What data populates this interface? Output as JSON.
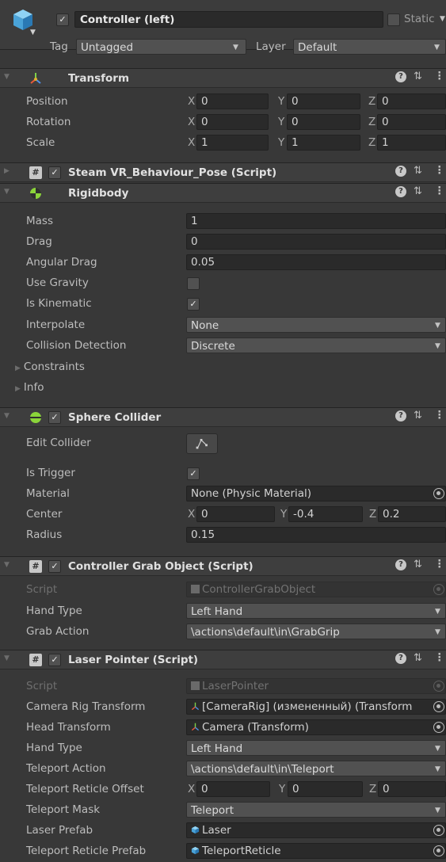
{
  "header": {
    "object_name": "Controller (left)",
    "active": true,
    "static_label": "Static",
    "tag_label": "Tag",
    "tag_value": "Untagged",
    "layer_label": "Layer",
    "layer_value": "Default"
  },
  "transform": {
    "title": "Transform",
    "rows": [
      {
        "label": "Position",
        "x": "0",
        "y": "0",
        "z": "0"
      },
      {
        "label": "Rotation",
        "x": "0",
        "y": "0",
        "z": "0"
      },
      {
        "label": "Scale",
        "x": "1",
        "y": "1",
        "z": "1"
      }
    ],
    "axis": {
      "x": "X",
      "y": "Y",
      "z": "Z"
    }
  },
  "steamvr_pose": {
    "title": "Steam VR_Behaviour_Pose (Script)",
    "enabled": true
  },
  "rigidbody": {
    "title": "Rigidbody",
    "mass_label": "Mass",
    "mass": "1",
    "drag_label": "Drag",
    "drag": "0",
    "angular_drag_label": "Angular Drag",
    "angular_drag": "0.05",
    "use_gravity_label": "Use Gravity",
    "use_gravity": false,
    "is_kinematic_label": "Is Kinematic",
    "is_kinematic": true,
    "interpolate_label": "Interpolate",
    "interpolate": "None",
    "collision_label": "Collision Detection",
    "collision": "Discrete",
    "constraints_label": "Constraints",
    "info_label": "Info"
  },
  "sphere_collider": {
    "title": "Sphere Collider",
    "enabled": true,
    "edit_label": "Edit Collider",
    "is_trigger_label": "Is Trigger",
    "is_trigger": true,
    "material_label": "Material",
    "material": "None (Physic Material)",
    "center_label": "Center",
    "center_x": "0",
    "center_y": "-0.4",
    "center_z": "0.2",
    "radius_label": "Radius",
    "radius": "0.15"
  },
  "grab_object": {
    "title": "Controller Grab Object (Script)",
    "enabled": true,
    "script_label": "Script",
    "script": "ControllerGrabObject",
    "hand_type_label": "Hand Type",
    "hand_type": "Left Hand",
    "grab_action_label": "Grab Action",
    "grab_action": "\\actions\\default\\in\\GrabGrip"
  },
  "laser_pointer": {
    "title": "Laser Pointer (Script)",
    "enabled": true,
    "script_label": "Script",
    "script": "LaserPointer",
    "camera_rig_label": "Camera Rig Transform",
    "camera_rig": "[CameraRig] (измененный) (Transform",
    "head_label": "Head Transform",
    "head": "Camera (Transform)",
    "hand_type_label": "Hand Type",
    "hand_type": "Left Hand",
    "teleport_action_label": "Teleport Action",
    "teleport_action": "\\actions\\default\\in\\Teleport",
    "reticle_offset_label": "Teleport Reticle Offset",
    "offset_x": "0",
    "offset_y": "0",
    "offset_z": "0",
    "mask_label": "Teleport Mask",
    "mask": "Teleport",
    "laser_prefab_label": "Laser Prefab",
    "laser_prefab": "Laser",
    "reticle_prefab_label": "Teleport Reticle Prefab",
    "reticle_prefab": "TeleportReticle"
  },
  "colors": {
    "panel": "#383838",
    "field": "#2a2a2a",
    "header": "#3e3e3e",
    "text": "#c4c4c4"
  }
}
